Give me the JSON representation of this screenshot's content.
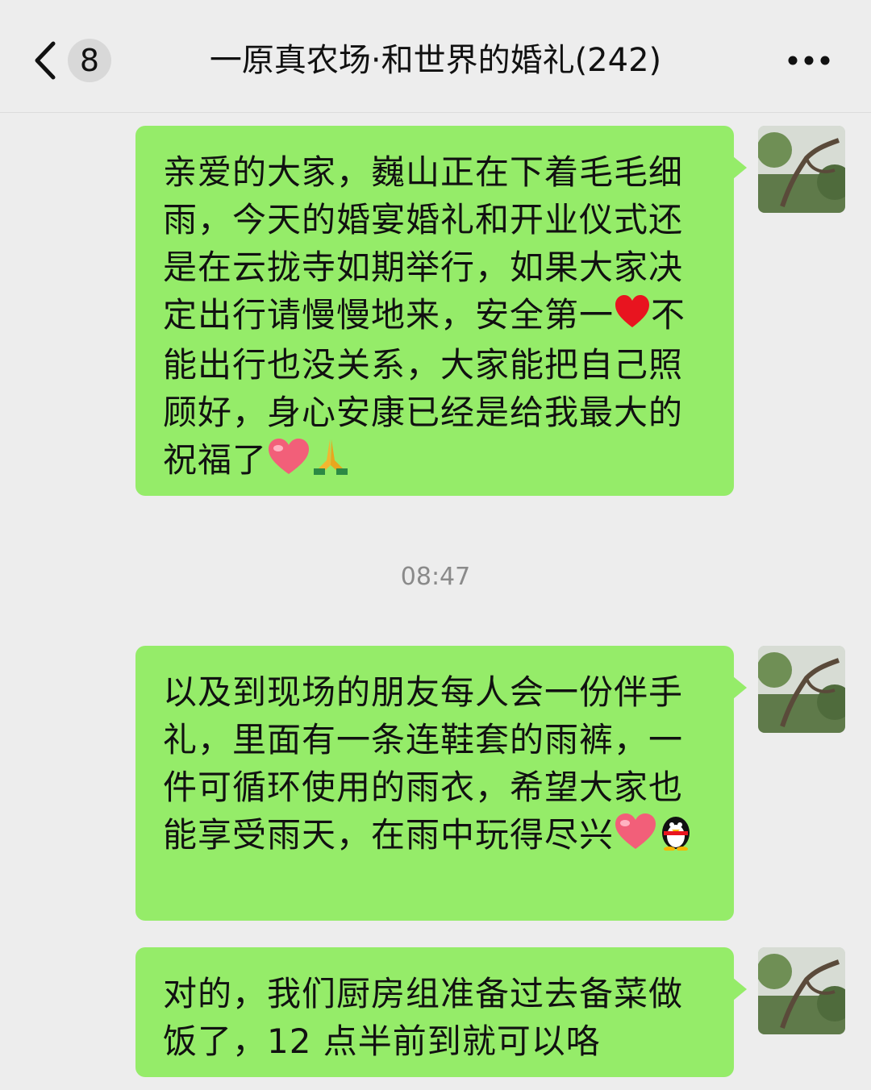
{
  "header": {
    "back_label": "back",
    "unread_count": "8",
    "title": "一原真农场·和世界的婚礼(242)",
    "more_icon": "more-horizontal-icon"
  },
  "messages": [
    {
      "text_parts": [
        "亲爱的大家，巍山正在下着毛毛细雨，今天的婚宴婚礼和开业仪式还是在云拢寺如期举行，如果大家决定出行请慢慢地来，安全第一",
        "不能出行也没关系，大家能把自己照顾好，身心安康已经是给我最大的祝福了"
      ],
      "emojis": [
        "red-heart-emoji",
        "pink-heart-emoji",
        "praying-hands-emoji"
      ]
    },
    {
      "text_parts": [
        "以及到现场的朋友每人会一份伴手礼，里面有一条连鞋套的雨裤，一件可循环使用的雨衣，希望大家也能享受雨天，在雨中玩得尽兴"
      ],
      "emojis": [
        "pink-heart-emoji",
        "penguin-emoji"
      ]
    },
    {
      "text_parts": [
        "对的，我们厨房组准备过去备菜做饭了，12 点半前到就可以咯"
      ],
      "emojis": []
    }
  ],
  "timestamp": "08:47",
  "colors": {
    "bubble": "#95ec69",
    "background": "#ededed",
    "timestamp": "#8a8a8a"
  }
}
